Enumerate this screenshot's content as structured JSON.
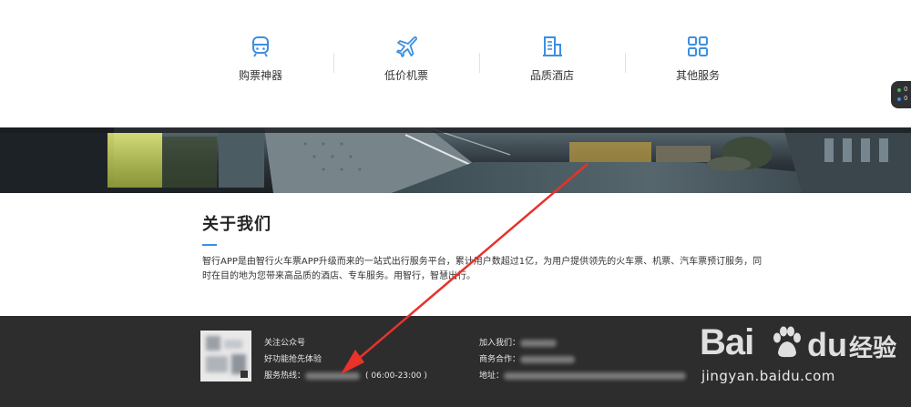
{
  "nav": {
    "items": [
      {
        "label": "购票神器",
        "icon": "train-icon"
      },
      {
        "label": "低价机票",
        "icon": "airplane-icon"
      },
      {
        "label": "品质酒店",
        "icon": "hotel-building-icon"
      },
      {
        "label": "其他服务",
        "icon": "grid-apps-icon"
      }
    ],
    "accent": "#3d8fe0",
    "side_widget": {
      "line1": "0",
      "line2": "0"
    }
  },
  "about": {
    "title": "关于我们",
    "text": "智行APP是由智行火车票APP升级而来的一站式出行服务平台，累计用户数超过1亿，为用户提供领先的火车票、机票、汽车票预订服务，同时在目的地为您带来高品质的酒店、专车服务。用智行，智慧出行。"
  },
  "footer": {
    "follow": "关注公众号",
    "slogan": "好功能抢先体验",
    "hotline_label": "服务热线：",
    "hotline_hours": "( 06:00-23:00 )",
    "join_label": "加入我们：",
    "business_label": "商务合作：",
    "address_label": "地址：",
    "background": "#2d2d2d"
  },
  "watermark": {
    "brand_bai": "Bai",
    "brand_du": "du",
    "brand_cn": "经验",
    "url": "jingyan.baidu.com"
  },
  "annotation": {
    "arrow_color": "#e8322a"
  }
}
